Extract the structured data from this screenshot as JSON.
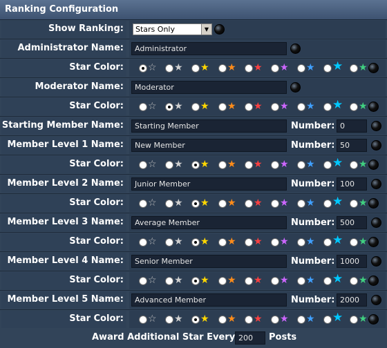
{
  "title": "Ranking Configuration",
  "show_ranking": {
    "label": "Show Ranking:",
    "selected": "Stars Only"
  },
  "number_label": "Number:",
  "star_color_label": "Star Color:",
  "star_colors": [
    "#c0c0c0",
    "#d0d0d0",
    "#ffd700",
    "#ff8c1a",
    "#ff4040",
    "#cc66ff",
    "#40a0ff",
    "#00c8ff",
    "#40d080"
  ],
  "ranks": [
    {
      "name_label": "Administrator Name:",
      "name": "Administrator",
      "number": null,
      "selected_star": 0
    },
    {
      "name_label": "Moderator Name:",
      "name": "Moderator",
      "number": null,
      "selected_star": 1
    },
    {
      "name_label": "Starting Member Name:",
      "name": "Starting Member",
      "number": "0",
      "selected_star": null
    },
    {
      "name_label": "Member Level 1 Name:",
      "name": "New Member",
      "number": "50",
      "selected_star": 2
    },
    {
      "name_label": "Member Level 2 Name:",
      "name": "Junior Member",
      "number": "100",
      "selected_star": 2
    },
    {
      "name_label": "Member Level 3 Name:",
      "name": "Average Member",
      "number": "500",
      "selected_star": 2
    },
    {
      "name_label": "Member Level 4 Name:",
      "name": "Senior Member",
      "number": "1000",
      "selected_star": 2
    },
    {
      "name_label": "Member Level 5 Name:",
      "name": "Advanced Member",
      "number": "2000",
      "selected_star": 2
    }
  ],
  "footer": {
    "prefix": "Award Additional Star Every",
    "value": "200",
    "suffix": "Posts"
  }
}
